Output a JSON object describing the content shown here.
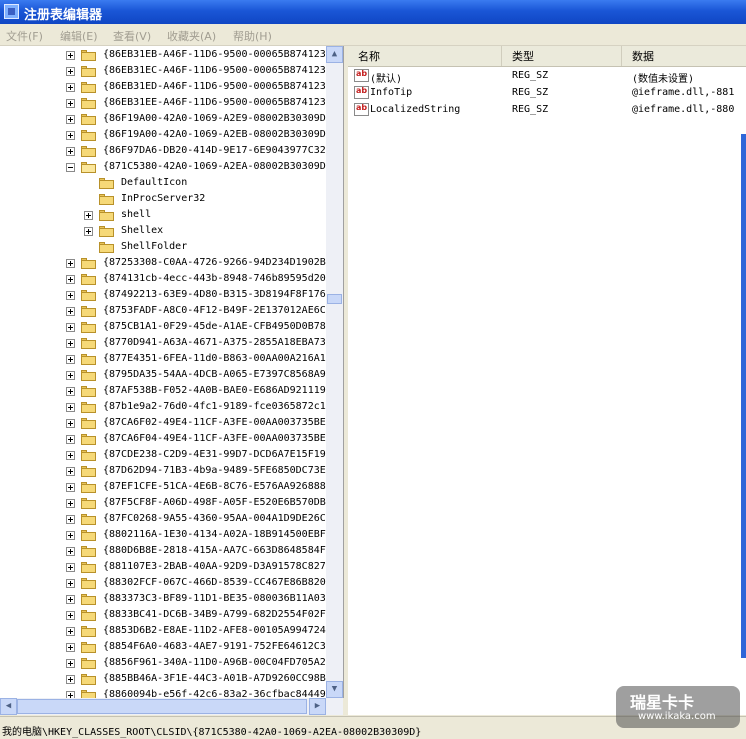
{
  "window": {
    "title": "注册表编辑器"
  },
  "menu": [
    "文件(F)",
    "编辑(E)",
    "查看(V)",
    "收藏夹(A)",
    "帮助(H)"
  ],
  "tree": {
    "rows": [
      {
        "label": "{86EB31EB-A46F-11D6-9500-00065B874123",
        "level": 0,
        "expander": "plus"
      },
      {
        "label": "{86EB31EC-A46F-11D6-9500-00065B874123",
        "level": 0,
        "expander": "plus"
      },
      {
        "label": "{86EB31ED-A46F-11D6-9500-00065B874123",
        "level": 0,
        "expander": "plus"
      },
      {
        "label": "{86EB31EE-A46F-11D6-9500-00065B874123",
        "level": 0,
        "expander": "plus"
      },
      {
        "label": "{86F19A00-42A0-1069-A2E9-08002B30309D",
        "level": 0,
        "expander": "plus"
      },
      {
        "label": "{86F19A00-42A0-1069-A2EB-08002B30309D",
        "level": 0,
        "expander": "plus"
      },
      {
        "label": "{86F97DA6-DB20-414D-9E17-6E9043977C32",
        "level": 0,
        "expander": "plus"
      },
      {
        "label": "{871C5380-42A0-1069-A2EA-08002B30309D",
        "level": 0,
        "expander": "minus",
        "open": true
      },
      {
        "label": "DefaultIcon",
        "level": 1,
        "expander": "none"
      },
      {
        "label": "InProcServer32",
        "level": 1,
        "expander": "none"
      },
      {
        "label": "shell",
        "level": 1,
        "expander": "plus"
      },
      {
        "label": "Shellex",
        "level": 1,
        "expander": "plus"
      },
      {
        "label": "ShellFolder",
        "level": 1,
        "expander": "none"
      },
      {
        "label": "{87253308-C0AA-4726-9266-94D234D1902B",
        "level": 0,
        "expander": "plus"
      },
      {
        "label": "{874131cb-4ecc-443b-8948-746b89595d20",
        "level": 0,
        "expander": "plus"
      },
      {
        "label": "{87492213-63E9-4D80-B315-3D8194F8F176",
        "level": 0,
        "expander": "plus"
      },
      {
        "label": "{8753FADF-A8C0-4F12-B49F-2E137012AE6C",
        "level": 0,
        "expander": "plus"
      },
      {
        "label": "{875CB1A1-0F29-45de-A1AE-CFB4950D0B78",
        "level": 0,
        "expander": "plus"
      },
      {
        "label": "{8770D941-A63A-4671-A375-2855A18EBA73",
        "level": 0,
        "expander": "plus"
      },
      {
        "label": "{877E4351-6FEA-11d0-B863-00AA00A216A1",
        "level": 0,
        "expander": "plus"
      },
      {
        "label": "{8795DA35-54AA-4DCB-A065-E7397C8568A9",
        "level": 0,
        "expander": "plus"
      },
      {
        "label": "{87AF538B-F052-4A0B-BAE0-E686AD921119",
        "level": 0,
        "expander": "plus"
      },
      {
        "label": "{87b1e9a2-76d0-4fc1-9189-fce0365872c1",
        "level": 0,
        "expander": "plus"
      },
      {
        "label": "{87CA6F02-49E4-11CF-A3FE-00AA003735BE",
        "level": 0,
        "expander": "plus"
      },
      {
        "label": "{87CA6F04-49E4-11CF-A3FE-00AA003735BE",
        "level": 0,
        "expander": "plus"
      },
      {
        "label": "{87CDE238-C2D9-4E31-99D7-DCD6A7E15F19",
        "level": 0,
        "expander": "plus"
      },
      {
        "label": "{87D62D94-71B3-4b9a-9489-5FE6850DC73E",
        "level": 0,
        "expander": "plus"
      },
      {
        "label": "{87EF1CFE-51CA-4E6B-8C76-E576AA926888",
        "level": 0,
        "expander": "plus"
      },
      {
        "label": "{87F5CF8F-A06D-498F-A05F-E520E6B570DB",
        "level": 0,
        "expander": "plus"
      },
      {
        "label": "{87FC0268-9A55-4360-95AA-004A1D9DE26C",
        "level": 0,
        "expander": "plus"
      },
      {
        "label": "{8802116A-1E30-4134-A02A-18B914500EBF",
        "level": 0,
        "expander": "plus"
      },
      {
        "label": "{880D6B8E-2818-415A-AA7C-663D8648584F",
        "level": 0,
        "expander": "plus"
      },
      {
        "label": "{881107E3-2BAB-40AA-92D9-D3A91578C827",
        "level": 0,
        "expander": "plus"
      },
      {
        "label": "{88302FCF-067C-466D-8539-CC467E86B820",
        "level": 0,
        "expander": "plus"
      },
      {
        "label": "{883373C3-BF89-11D1-BE35-080036B11A03",
        "level": 0,
        "expander": "plus"
      },
      {
        "label": "{8833BC41-DC6B-34B9-A799-682D2554F02F",
        "level": 0,
        "expander": "plus"
      },
      {
        "label": "{8853D6B2-E8AE-11D2-AFE8-00105A994724",
        "level": 0,
        "expander": "plus"
      },
      {
        "label": "{8854F6A0-4683-4AE7-9191-752FE64612C3",
        "level": 0,
        "expander": "plus"
      },
      {
        "label": "{8856F961-340A-11D0-A96B-00C04FD705A2",
        "level": 0,
        "expander": "plus"
      },
      {
        "label": "{885BB46A-3F1E-44C3-A01B-A7D9260CC98B",
        "level": 0,
        "expander": "plus"
      },
      {
        "label": "{8860094b-e56f-42c6-83a2-36cfbac84449",
        "level": 0,
        "expander": "plus"
      }
    ]
  },
  "values": {
    "columns": [
      "名称",
      "类型",
      "数据"
    ],
    "rows": [
      {
        "name": "(默认)",
        "type": "REG_SZ",
        "data": "(数值未设置)"
      },
      {
        "name": "InfoTip",
        "type": "REG_SZ",
        "data": "@ieframe.dll,-881"
      },
      {
        "name": "LocalizedString",
        "type": "REG_SZ",
        "data": "@ieframe.dll,-880"
      }
    ]
  },
  "status": {
    "path": "我的电脑\\HKEY_CLASSES_ROOT\\CLSID\\{871C5380-42A0-1069-A2EA-08002B30309D}"
  },
  "watermark": {
    "main": "瑞星卡卡",
    "url": "www.ikaka.com"
  },
  "icons": {
    "app": "registry-editor-icon",
    "folder": "folder-icon",
    "string_value": "string-value-icon"
  }
}
